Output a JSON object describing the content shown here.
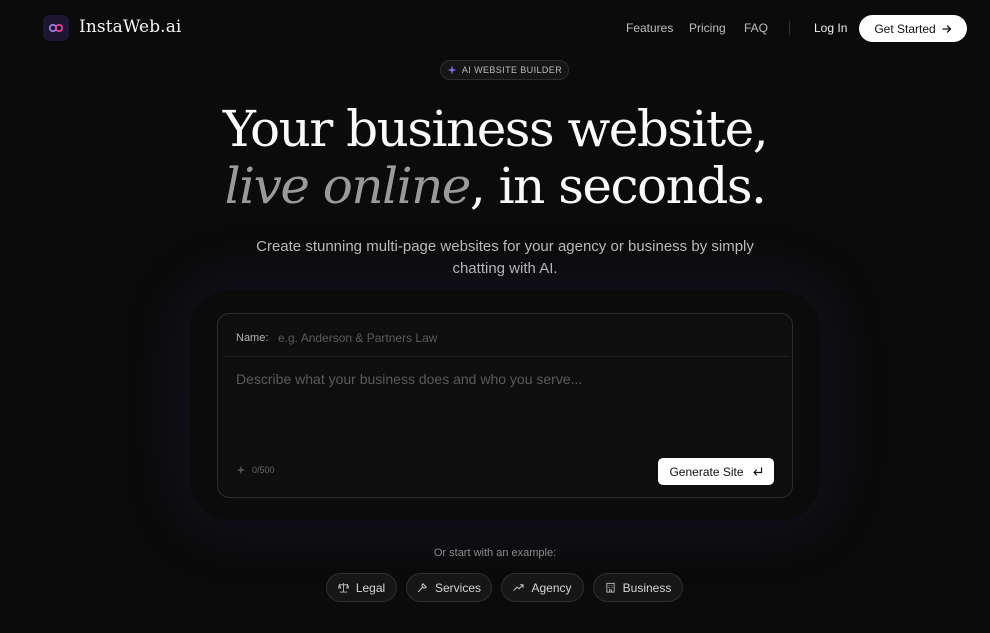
{
  "brand": {
    "name": "InstaWeb.ai",
    "accent": "#8b5cf6"
  },
  "nav": {
    "links": [
      "Features",
      "Pricing",
      "FAQ"
    ],
    "login": "Log In",
    "cta": "Get Started"
  },
  "hero": {
    "badge": "AI WEBSITE BUILDER",
    "title_line1": "Your business website,",
    "title_accent": "live online",
    "title_rest": ", in seconds.",
    "subtitle": "Create stunning multi-page websites for your agency or business by simply chatting with AI."
  },
  "form": {
    "name_label": "Name:",
    "name_placeholder": "e.g. Anderson & Partners Law",
    "desc_placeholder": "Describe what your business does and who you serve...",
    "counter": "0/500",
    "generate_label": "Generate Site"
  },
  "examples": {
    "prompt": "Or start with an example:",
    "chips": [
      {
        "label": "Legal",
        "icon": "scale-icon"
      },
      {
        "label": "Services",
        "icon": "wrench-icon"
      },
      {
        "label": "Agency",
        "icon": "trend-icon"
      },
      {
        "label": "Business",
        "icon": "building-icon"
      }
    ]
  }
}
